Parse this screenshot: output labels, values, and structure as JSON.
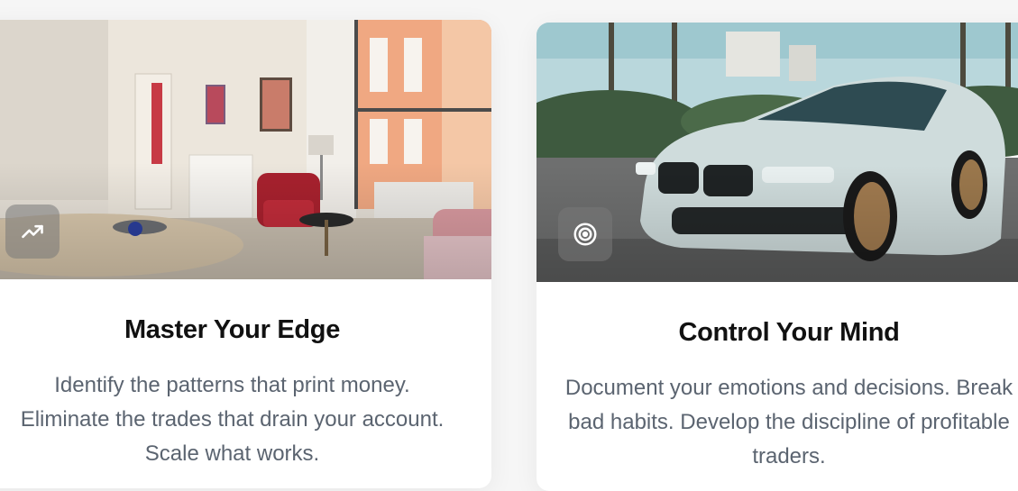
{
  "cards": [
    {
      "title": "Master Your Edge",
      "text": "Identify the patterns that print money. Eliminate the trades that drain your account. Scale what works.",
      "icon": "trending-up-icon",
      "image": "living-room-photo"
    },
    {
      "title": "Control Your Mind",
      "text": "Document your emotions and decisions. Break bad habits. Develop the discipline of profitable traders.",
      "icon": "target-icon",
      "image": "car-photo"
    }
  ],
  "colors": {
    "title": "#111111",
    "body_text": "#5b6470",
    "card_bg": "#ffffff",
    "page_bg": "#f6f6f6"
  }
}
